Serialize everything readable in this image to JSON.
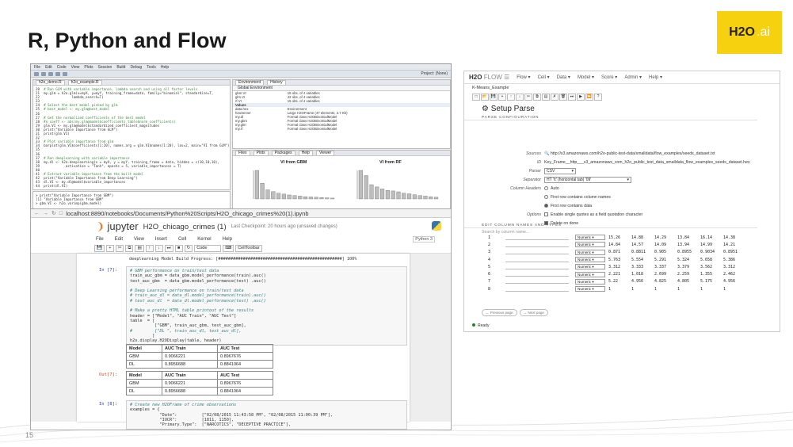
{
  "slide": {
    "title": "R, Python and Flow",
    "number": "15",
    "logo_h2o": "H2O",
    "logo_ai": ".ai",
    "accent": "#f5d10f"
  },
  "rstudio": {
    "menu": [
      "File",
      "Edit",
      "Code",
      "View",
      "Plots",
      "Session",
      "Build",
      "Debug",
      "Tools",
      "Help"
    ],
    "project": "Project: (None)",
    "tabs": [
      "h2o_demo.R",
      "h2o_example.R"
    ],
    "code_lines": [
      {
        "n": "20",
        "t": "# Run GLM with variable importance, lambda search and using all factor levels",
        "c": true
      },
      {
        "n": "21",
        "t": "my.glm = h2o.glm(x=myX, y=myY, training_frame=data, family=\"binomial\", standardize=T,",
        "c": false
      },
      {
        "n": "22",
        "t": "              lambda_search=T)",
        "c": false
      },
      {
        "n": "23",
        "t": "",
        "c": false
      },
      {
        "n": "24",
        "t": "# Select the best model picked by glm",
        "c": true
      },
      {
        "n": "25",
        "t": "# best_model <- my.glm@best_model",
        "c": true
      },
      {
        "n": "26",
        "t": "",
        "c": false
      },
      {
        "n": "27",
        "t": "# Get the normalized coefficients of the best model",
        "c": true
      },
      {
        "n": "28",
        "t": "#n_coeff <- abs(my.glm@model$coefficients_table$norm_coefficients)",
        "c": true
      },
      {
        "n": "29",
        "t": "glm.VI <- my.glm@model$standardized_coefficient_magnitudes",
        "c": false
      },
      {
        "n": "30",
        "t": "print(\"Variable Importance from GLM\")",
        "c": false
      },
      {
        "n": "31",
        "t": "print(glm.VI)",
        "c": false
      },
      {
        "n": "32",
        "t": "",
        "c": false
      },
      {
        "n": "33",
        "t": "# Plot variable importance from glm",
        "c": true
      },
      {
        "n": "34",
        "t": "barplot(glm.VI$coefficients[1:20], names.arg = glm.VI$names[1:20], las=2, main=\"VI from GLM\")",
        "c": false
      },
      {
        "n": "35",
        "t": "",
        "c": false
      },
      {
        "n": "36",
        "t": "",
        "c": false
      },
      {
        "n": "37",
        "t": "# Run deeplearning with variable importance",
        "c": true
      },
      {
        "n": "38",
        "t": "my.dl <- h2o.deeplearning(x = myX, y = myY, training_frame = data, hidden = c(10,10,10),",
        "c": false
      },
      {
        "n": "39",
        "t": "           activation = \"Tanh\", epochs = 5, variable_importances = T)",
        "c": false
      },
      {
        "n": "40",
        "t": "",
        "c": false
      },
      {
        "n": "41",
        "t": "# Extract variable importance from the built model",
        "c": true
      },
      {
        "n": "42",
        "t": "print(\"Variable Importance from Deep Learning\")",
        "c": false
      },
      {
        "n": "43",
        "t": "dl.VI <- my.dl@model$variable_importances",
        "c": false
      },
      {
        "n": "44",
        "t": "print(dl.VI)",
        "c": false
      }
    ],
    "console_lines": [
      "> print(\"Variable Importance from GBM\")",
      "[1] \"Variable Importance from GBM\"",
      "> gbm.VI <- h2o.varimp(gbm.model)"
    ],
    "env_tabs": [
      "Environment",
      "History"
    ],
    "env_scope": "Global Environment",
    "env_rows": [
      {
        "k": "gbm.VI",
        "v": "15 obs. of 4 variables",
        "sec": false
      },
      {
        "k": "glm.VI",
        "v": "42 obs. of 4 variables",
        "sec": false
      },
      {
        "k": "rf.VI",
        "v": "15 obs. of 4 variables",
        "sec": false
      },
      {
        "k": "Values",
        "v": "",
        "sec": true
      },
      {
        "k": "data.hex",
        "v": "Environment",
        "sec": false
      },
      {
        "k": "h2oServer",
        "v": "Large H2OFrame (47 elements, 3.7 Kb)",
        "sec": false
      },
      {
        "k": "my.dl",
        "v": "Formal class H2OBinomialModel",
        "sec": false
      },
      {
        "k": "my.gbm",
        "v": "Formal class H2OBinomialModel",
        "sec": false
      },
      {
        "k": "my.glm",
        "v": "Formal class H2OBinomialModel",
        "sec": false
      },
      {
        "k": "my.rf",
        "v": "Formal class H2OBinomialModel",
        "sec": false
      }
    ],
    "plot_tabs": [
      "Files",
      "Plots",
      "Packages",
      "Help",
      "Viewer"
    ],
    "plot_titles": [
      "VI from GBM",
      "VI from RF"
    ],
    "bars_gbm": [
      1.0,
      0.55,
      0.32,
      0.26,
      0.2,
      0.17,
      0.14,
      0.12,
      0.1,
      0.08,
      0.07,
      0.06,
      0.05,
      0.04,
      0.03
    ],
    "bars_rf": [
      1.0,
      0.82,
      0.5,
      0.42,
      0.35,
      0.3,
      0.28,
      0.25,
      0.2,
      0.18,
      0.15,
      0.12,
      0.1,
      0.08,
      0.06
    ]
  },
  "jupyter": {
    "url": "localhost:8890/notebooks/Documents/Python%20Scripts/H2O_chicago_crimes%20(1).ipynb",
    "brand": "jupyter",
    "notebook_name": "H2O_chicago_crimes (1)",
    "checkpoint": "Last Checkpoint: 20 hours ago (unsaved changes)",
    "menu": [
      "File",
      "Edit",
      "View",
      "Insert",
      "Cell",
      "Kernel",
      "Help"
    ],
    "kernel": "Python 3",
    "cell_type": "Code",
    "celltoolbar": "CellToolbar",
    "progress_line": "deeplearning Model Build Progress: [##################################################] 100%",
    "prompt_in7": "In [7]:",
    "prompt_out7": "Out[7]:",
    "prompt_in8": "In [8]:",
    "cell7_lines": [
      {
        "t": "# GBM performance on train/test data",
        "c": true
      },
      {
        "t": "train_auc_gbm = data_gbm.model_performance(train).auc()",
        "c": false
      },
      {
        "t": "test_auc_gbm  = data_gbm.model_performance(test) .auc()",
        "c": false
      },
      {
        "t": "",
        "c": false
      },
      {
        "t": "# Deep Learning performance on train/test data",
        "c": true
      },
      {
        "t": "# train_auc_dl = data_dl.model_performance(train).auc()",
        "c": true
      },
      {
        "t": "# test_auc_dl  = data_dl.model_performance(test) .auc()",
        "c": true
      },
      {
        "t": "",
        "c": false
      },
      {
        "t": "# Make a pretty HTML table printout of the results",
        "c": true
      },
      {
        "t": "header = [\"Model\", \"AUC Train\", \"AUC Test\"]",
        "c": false
      },
      {
        "t": "table  = [",
        "c": false
      },
      {
        "t": "          [\"GBM\", train_auc_gbm, test_auc_gbm],",
        "c": false
      },
      {
        "t": "#         [\"DL \", train_auc_dl, test_auc_dl],",
        "c": true
      },
      {
        "t": "         ]",
        "c": false
      },
      {
        "t": "h2o.display.H2ODisplay(table, header)",
        "c": false
      }
    ],
    "table_header": [
      "Model",
      "AUC Train",
      "AUC Test"
    ],
    "table_rows": [
      [
        "GBM",
        "0.9066221",
        "0.8967676"
      ],
      [
        "DL",
        "0.8956688",
        "0.8841064"
      ]
    ],
    "out_table_rows": [
      [
        "GBM",
        "0.9066221",
        "0.8967676"
      ],
      [
        "DL",
        "0.8956688",
        "0.8841064"
      ]
    ],
    "cell8_lines": [
      {
        "t": "# Create new H2OFrame of crime observations",
        "c": true
      },
      {
        "t": "examples = {",
        "c": false
      },
      {
        "t": "            \"Date\":          [\"02/08/2015 11:43:58 PM\", \"02/08/2015 11:00:39 PM\"],",
        "c": false
      },
      {
        "t": "            \"IUCR\":          [1811, 1150],",
        "c": false
      },
      {
        "t": "            \"Primary.Type\":  [\"NARCOTICS\", \"DECEPTIVE PRACTICE\"],",
        "c": false
      }
    ]
  },
  "flow": {
    "brand": "H2O",
    "brand_flow": "FLOW",
    "menu": [
      "Flow",
      "Cell",
      "Data",
      "Model",
      "Score",
      "Admin",
      "Help"
    ],
    "doc_name": "K-Means_Example",
    "heading": "Setup Parse",
    "section_config": "PARSE CONFIGURATION",
    "sources_label": "Sources",
    "sources_value": "http://s3.amazonaws.com/h2o-public-test-data/smalldata/flow_examples/seeds_dataset.txt",
    "id_label": "ID",
    "id_value": "Key_Frame__http___s3_amazonaws_com_h2o_public_test_data_smalldata_flow_examples_seeds_dataset.hex",
    "parser_label": "Parser",
    "parser_value": "CSV",
    "separator_label": "Separator",
    "separator_value": "HT '\\t' (horizontal tab) '09'",
    "col_headers_label": "Column Headers",
    "opt_auto": "Auto",
    "opt_first_names": "First row contains column names",
    "opt_first_data": "First row contains data",
    "options_label": "Options",
    "opt_single_quotes": "Enable single quotes as a field quotation character",
    "opt_delete": "Delete on done",
    "section_columns": "EDIT COLUMN NAMES AND TYPES",
    "search_placeholder": "Search by column name...",
    "columns": [
      {
        "n": "1",
        "type": "Numeric",
        "vals": [
          "15.26",
          "14.88",
          "14.29",
          "13.84",
          "16.14",
          "14.38"
        ]
      },
      {
        "n": "2",
        "type": "Numeric",
        "vals": [
          "14.84",
          "14.57",
          "14.09",
          "13.94",
          "14.99",
          "14.21"
        ]
      },
      {
        "n": "3",
        "type": "Numeric",
        "vals": [
          "0.871",
          "0.8811",
          "0.905",
          "0.8955",
          "0.9034",
          "0.8951"
        ]
      },
      {
        "n": "4",
        "type": "Numeric",
        "vals": [
          "5.763",
          "5.554",
          "5.291",
          "5.324",
          "5.658",
          "5.386"
        ]
      },
      {
        "n": "5",
        "type": "Numeric",
        "vals": [
          "3.312",
          "3.333",
          "3.337",
          "3.379",
          "3.562",
          "3.312"
        ]
      },
      {
        "n": "6",
        "type": "Numeric",
        "vals": [
          "2.221",
          "1.018",
          "2.699",
          "2.259",
          "1.355",
          "2.462"
        ]
      },
      {
        "n": "7",
        "type": "Numeric",
        "vals": [
          "5.22",
          "4.956",
          "4.825",
          "4.805",
          "5.175",
          "4.956"
        ]
      },
      {
        "n": "8",
        "type": "Numeric",
        "vals": [
          "1",
          "1",
          "1",
          "1",
          "1",
          "1"
        ]
      }
    ],
    "prev_page": "Previous page",
    "next_page": "Next page",
    "status": "Ready"
  }
}
